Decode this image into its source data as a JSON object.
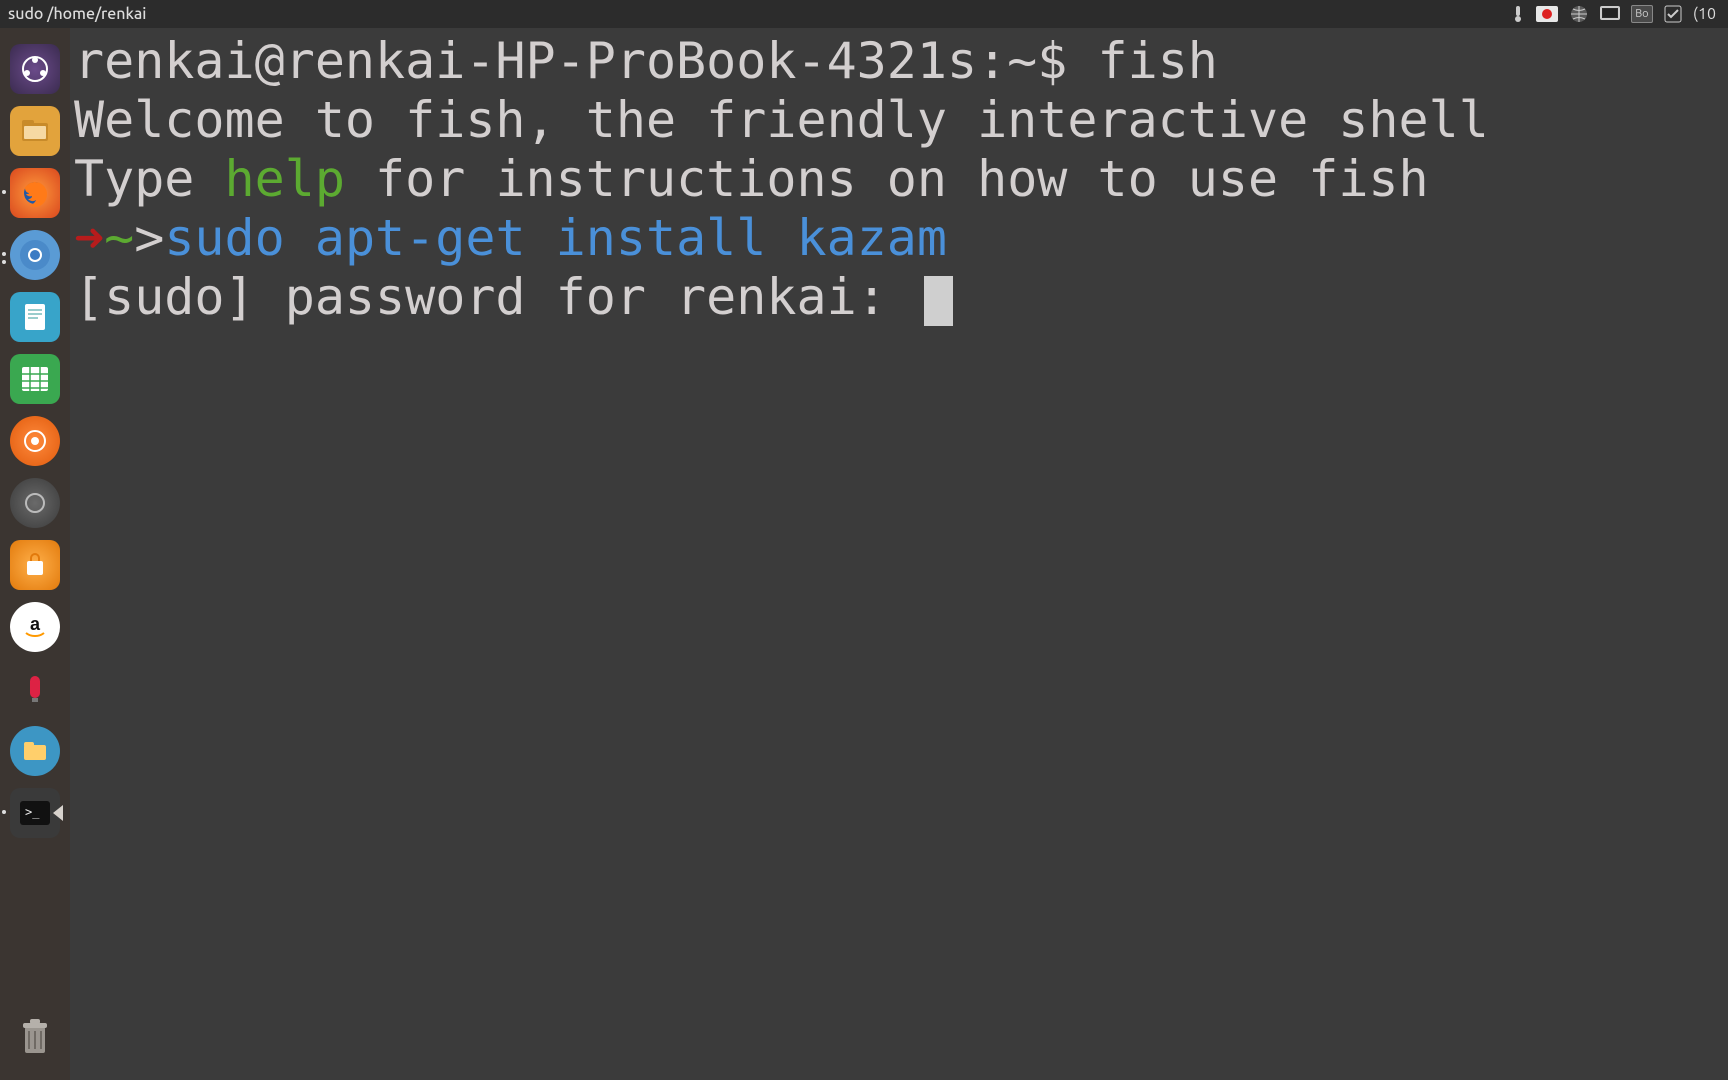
{
  "top_panel": {
    "title": "sudo /home/renkai",
    "battery_text": "(10",
    "badge_text": "Bo"
  },
  "launcher": {
    "items": [
      {
        "name": "dash"
      },
      {
        "name": "files"
      },
      {
        "name": "firefox"
      },
      {
        "name": "chromium"
      },
      {
        "name": "document-viewer"
      },
      {
        "name": "spreadsheet"
      },
      {
        "name": "orange-app"
      },
      {
        "name": "gray-app"
      },
      {
        "name": "software-center"
      },
      {
        "name": "amazon"
      },
      {
        "name": "red-app"
      },
      {
        "name": "files-2"
      },
      {
        "name": "terminal"
      }
    ],
    "trash": {
      "name": "trash"
    }
  },
  "terminal": {
    "line1_prompt": "renkai@renkai-HP-ProBook-4321s:~$ ",
    "line1_cmd": "fish",
    "line2": "Welcome to fish, the friendly interactive shell",
    "line3_a": "Type ",
    "line3_help": "help",
    "line3_b": " for instructions on how to use fish",
    "line4_arrow": "➜",
    "line4_tilde": "~",
    "line4_gt": ">",
    "line4_sudo": "sudo",
    "line4_rest": " apt-get install kazam",
    "line5": "[sudo] password for renkai: "
  }
}
